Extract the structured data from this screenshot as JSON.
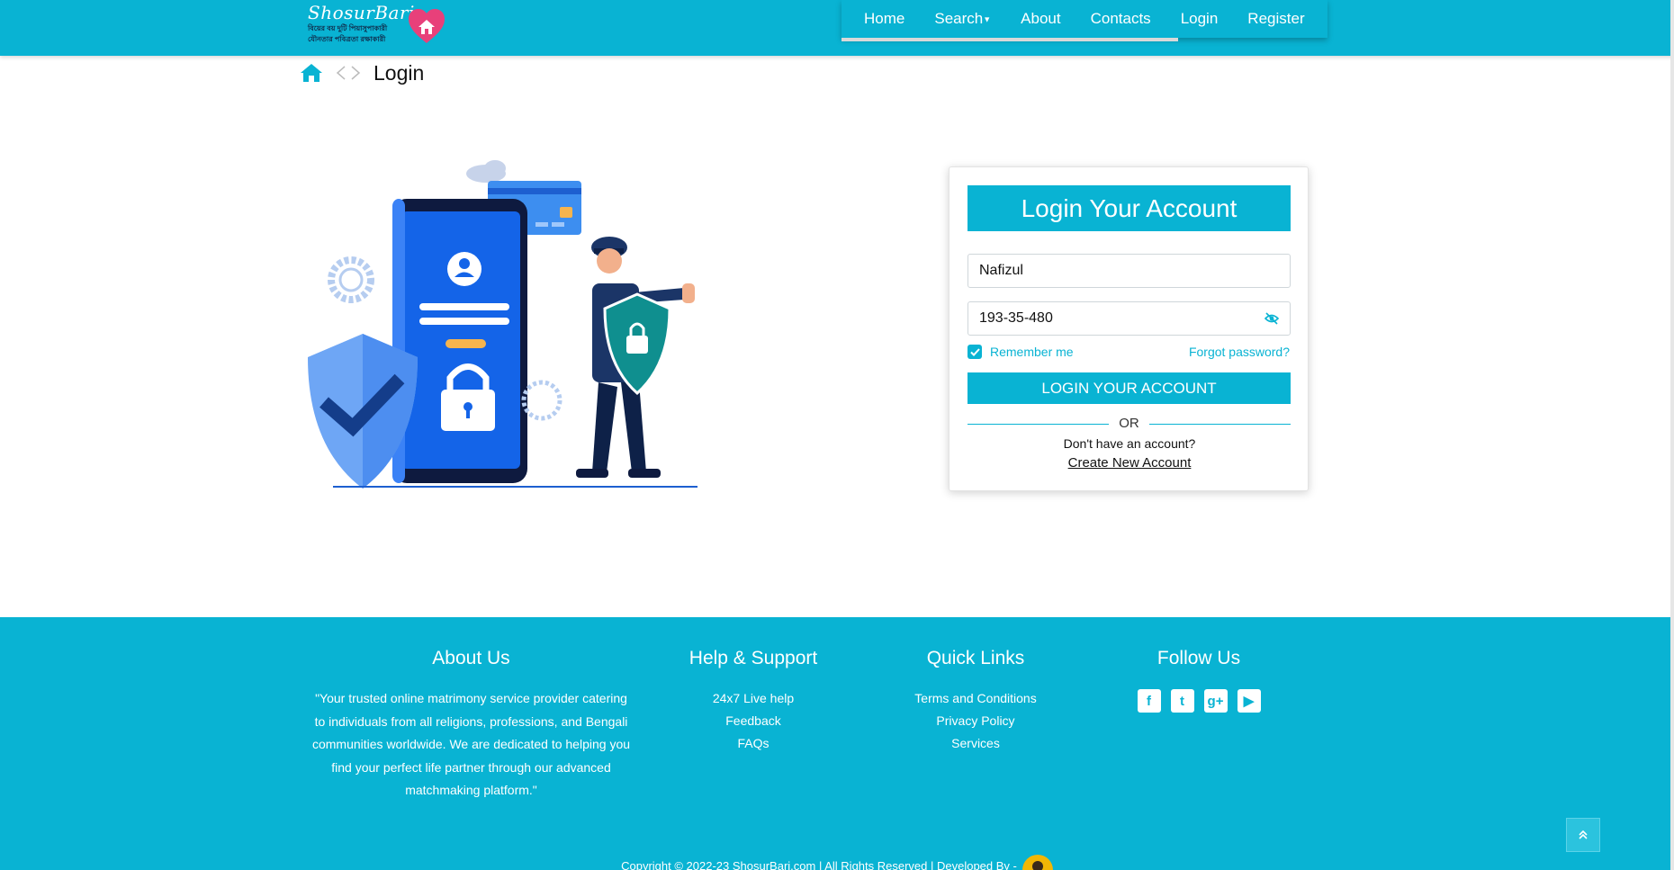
{
  "colors": {
    "brand": "#09b3d3",
    "white": "#ffffff"
  },
  "header": {
    "logo": {
      "name": "ShosurBari",
      "tagline": "বিয়ের বয় দুটি পিয়াসুপাকারী যৌনতার পবিত্রতা রক্ষাকারী"
    },
    "nav": [
      {
        "label": "Home"
      },
      {
        "label": "Search"
      },
      {
        "label": "About"
      },
      {
        "label": "Contacts"
      },
      {
        "label": "Login"
      },
      {
        "label": "Register"
      }
    ]
  },
  "breadcrumb": {
    "home_icon": "home-icon",
    "current": "Login"
  },
  "login_card": {
    "title": "Login Your Account",
    "username_value": "Nafizul",
    "password_value": "193-35-480",
    "remember_label": "Remember me",
    "remember_checked": true,
    "forgot_label": "Forgot password?",
    "submit_label": "LOGIN YOUR ACCOUNT",
    "or_label": "OR",
    "no_account_text": "Don't have an account?",
    "create_label": "Create New Account"
  },
  "footer": {
    "about": {
      "heading": "About Us",
      "text": "\"Your trusted online matrimony service provider catering to individuals from all religions, professions, and Bengali communities worldwide. We are dedicated to helping you find your perfect life partner through our advanced matchmaking platform.\""
    },
    "help": {
      "heading": "Help & Support",
      "links": [
        "24x7 Live help",
        "Feedback",
        "FAQs"
      ]
    },
    "quick": {
      "heading": "Quick Links",
      "links": [
        "Terms and Conditions",
        "Privacy Policy",
        "Services"
      ]
    },
    "follow": {
      "heading": "Follow Us",
      "icons": [
        {
          "name": "facebook-icon",
          "glyph": "f"
        },
        {
          "name": "twitter-icon",
          "glyph": "t"
        },
        {
          "name": "google-plus-icon",
          "glyph": "g+"
        },
        {
          "name": "youtube-icon",
          "glyph": "▶"
        }
      ]
    },
    "copyright": "Copyright © 2022-23 ShosurBari.com | All Rights Reserved | Developed By -"
  }
}
